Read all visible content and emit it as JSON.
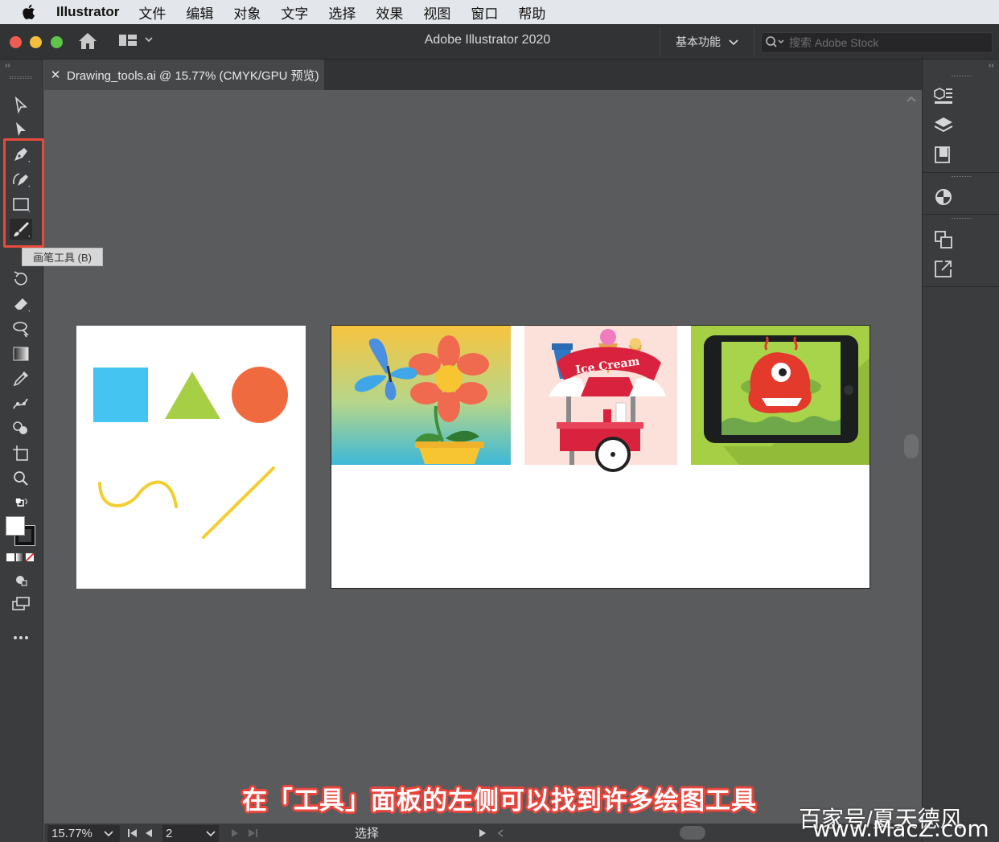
{
  "menubar": {
    "app_name": "Illustrator",
    "items": [
      "文件",
      "编辑",
      "对象",
      "文字",
      "选择",
      "效果",
      "视图",
      "窗口",
      "帮助"
    ]
  },
  "titlebar": {
    "title": "Adobe Illustrator 2020",
    "workspace": "基本功能",
    "search_placeholder": "搜索 Adobe Stock"
  },
  "document_tab": {
    "label": "Drawing_tools.ai @ 15.77% (CMYK/GPU 预览)"
  },
  "tools": {
    "tooltip": "画笔工具 (B)",
    "highlight_color": "#e74a3c"
  },
  "artboard2": {
    "icecream_text": "Ice Cream"
  },
  "statusbar": {
    "zoom": "15.77%",
    "page": "2",
    "mode": "选择"
  },
  "caption": "在「工具」面板的左侧可以找到许多绘图工具",
  "watermark": {
    "line1": "百家号/夏天德风",
    "line2": "www.MacZ.com"
  },
  "colors": {
    "square": "#44c4f1",
    "triangle": "#a6cf45",
    "circle": "#f06a40",
    "strokes": "#f4cd2f"
  }
}
